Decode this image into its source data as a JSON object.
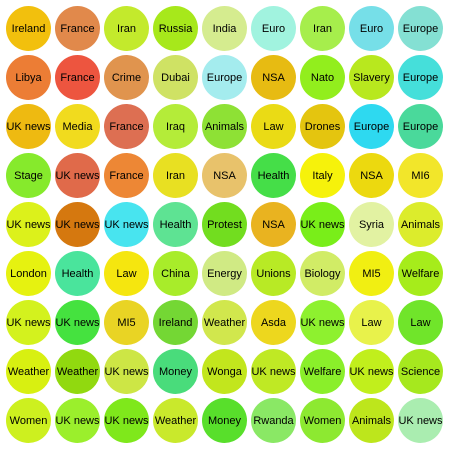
{
  "bubbles": [
    {
      "label": "Ireland",
      "color": "#f2c00d"
    },
    {
      "label": "France",
      "color": "#e1894b"
    },
    {
      "label": "Iran",
      "color": "#c3ea2c"
    },
    {
      "label": "Russia",
      "color": "#a7e81b"
    },
    {
      "label": "India",
      "color": "#d5ec8f"
    },
    {
      "label": "Euro",
      "color": "#a1f3df"
    },
    {
      "label": "Iran",
      "color": "#a6ee4c"
    },
    {
      "label": "Euro",
      "color": "#76dfe8"
    },
    {
      "label": "Europe",
      "color": "#84e0d3"
    },
    {
      "label": "Libya",
      "color": "#ec7d35"
    },
    {
      "label": "France",
      "color": "#ed553f"
    },
    {
      "label": "Crime",
      "color": "#e0944e"
    },
    {
      "label": "Dubai",
      "color": "#cfe264"
    },
    {
      "label": "Europe",
      "color": "#a4ecee"
    },
    {
      "label": "NSA",
      "color": "#e7bb12"
    },
    {
      "label": "Nato",
      "color": "#92ee1d"
    },
    {
      "label": "Slavery",
      "color": "#b8e81e"
    },
    {
      "label": "Europe",
      "color": "#45dfda"
    },
    {
      "label": "UK news",
      "color": "#eeba11"
    },
    {
      "label": "Media",
      "color": "#f1db1e"
    },
    {
      "label": "France",
      "color": "#dd6f52"
    },
    {
      "label": "Iraq",
      "color": "#b4ec39"
    },
    {
      "label": "Animals",
      "color": "#8ee135"
    },
    {
      "label": "Law",
      "color": "#eadb15"
    },
    {
      "label": "Drones",
      "color": "#e4c50f"
    },
    {
      "label": "Europe",
      "color": "#2ed9f0"
    },
    {
      "label": "Europe",
      "color": "#4ad99b"
    },
    {
      "label": "Stage",
      "color": "#86ea2c"
    },
    {
      "label": "UK news",
      "color": "#e06a4a"
    },
    {
      "label": "France",
      "color": "#ed8735"
    },
    {
      "label": "Iran",
      "color": "#e8e022"
    },
    {
      "label": "NSA",
      "color": "#e8c26b"
    },
    {
      "label": "Health",
      "color": "#45de48"
    },
    {
      "label": "Italy",
      "color": "#f6f20b"
    },
    {
      "label": "NSA",
      "color": "#ecd90f"
    },
    {
      "label": "MI6",
      "color": "#f2e62a"
    },
    {
      "label": "UK news",
      "color": "#dcf11b"
    },
    {
      "label": "UK news",
      "color": "#d5780f"
    },
    {
      "label": "UK news",
      "color": "#48e4ef"
    },
    {
      "label": "Health",
      "color": "#5ee393"
    },
    {
      "label": "Protest",
      "color": "#72dd1f"
    },
    {
      "label": "NSA",
      "color": "#e9b320"
    },
    {
      "label": "UK news",
      "color": "#79ee19"
    },
    {
      "label": "Syria",
      "color": "#e2f2a2"
    },
    {
      "label": "Animals",
      "color": "#dcec2c"
    },
    {
      "label": "London",
      "color": "#e6f210"
    },
    {
      "label": "Health",
      "color": "#4ae49c"
    },
    {
      "label": "Law",
      "color": "#f5e60f"
    },
    {
      "label": "China",
      "color": "#a8ec2a"
    },
    {
      "label": "Energy",
      "color": "#d0ea84"
    },
    {
      "label": "Unions",
      "color": "#b8ea25"
    },
    {
      "label": "Biology",
      "color": "#d1ec66"
    },
    {
      "label": "MI5",
      "color": "#f1ef12"
    },
    {
      "label": "Welfare",
      "color": "#a6ec1b"
    },
    {
      "label": "UK news",
      "color": "#d3f21e"
    },
    {
      "label": "UK news",
      "color": "#45e23f"
    },
    {
      "label": "MI5",
      "color": "#e9d424"
    },
    {
      "label": "Ireland",
      "color": "#74d734"
    },
    {
      "label": "Weather",
      "color": "#d1e74d"
    },
    {
      "label": "Asda",
      "color": "#edd71e"
    },
    {
      "label": "UK news",
      "color": "#8ef12f"
    },
    {
      "label": "Law",
      "color": "#e8f24b"
    },
    {
      "label": "Law",
      "color": "#70e52a"
    },
    {
      "label": "Weather",
      "color": "#d8f011"
    },
    {
      "label": "Weather",
      "color": "#91d90f"
    },
    {
      "label": "UK news",
      "color": "#cde645"
    },
    {
      "label": "Money",
      "color": "#49dc7b"
    },
    {
      "label": "Wonga",
      "color": "#c2e61d"
    },
    {
      "label": "UK news",
      "color": "#bfe924"
    },
    {
      "label": "Welfare",
      "color": "#8aef2a"
    },
    {
      "label": "UK news",
      "color": "#c1ef1c"
    },
    {
      "label": "Science",
      "color": "#a6e81e"
    },
    {
      "label": "Women",
      "color": "#cdf01f"
    },
    {
      "label": "UK news",
      "color": "#9bef2c"
    },
    {
      "label": "UK news",
      "color": "#7fe81b"
    },
    {
      "label": "Weather",
      "color": "#c9e92c"
    },
    {
      "label": "Money",
      "color": "#58df2b"
    },
    {
      "label": "Rwanda",
      "color": "#8ae865"
    },
    {
      "label": "Women",
      "color": "#8de931"
    },
    {
      "label": "Animals",
      "color": "#bde61c"
    },
    {
      "label": "UK news",
      "color": "#aaedb0"
    }
  ]
}
